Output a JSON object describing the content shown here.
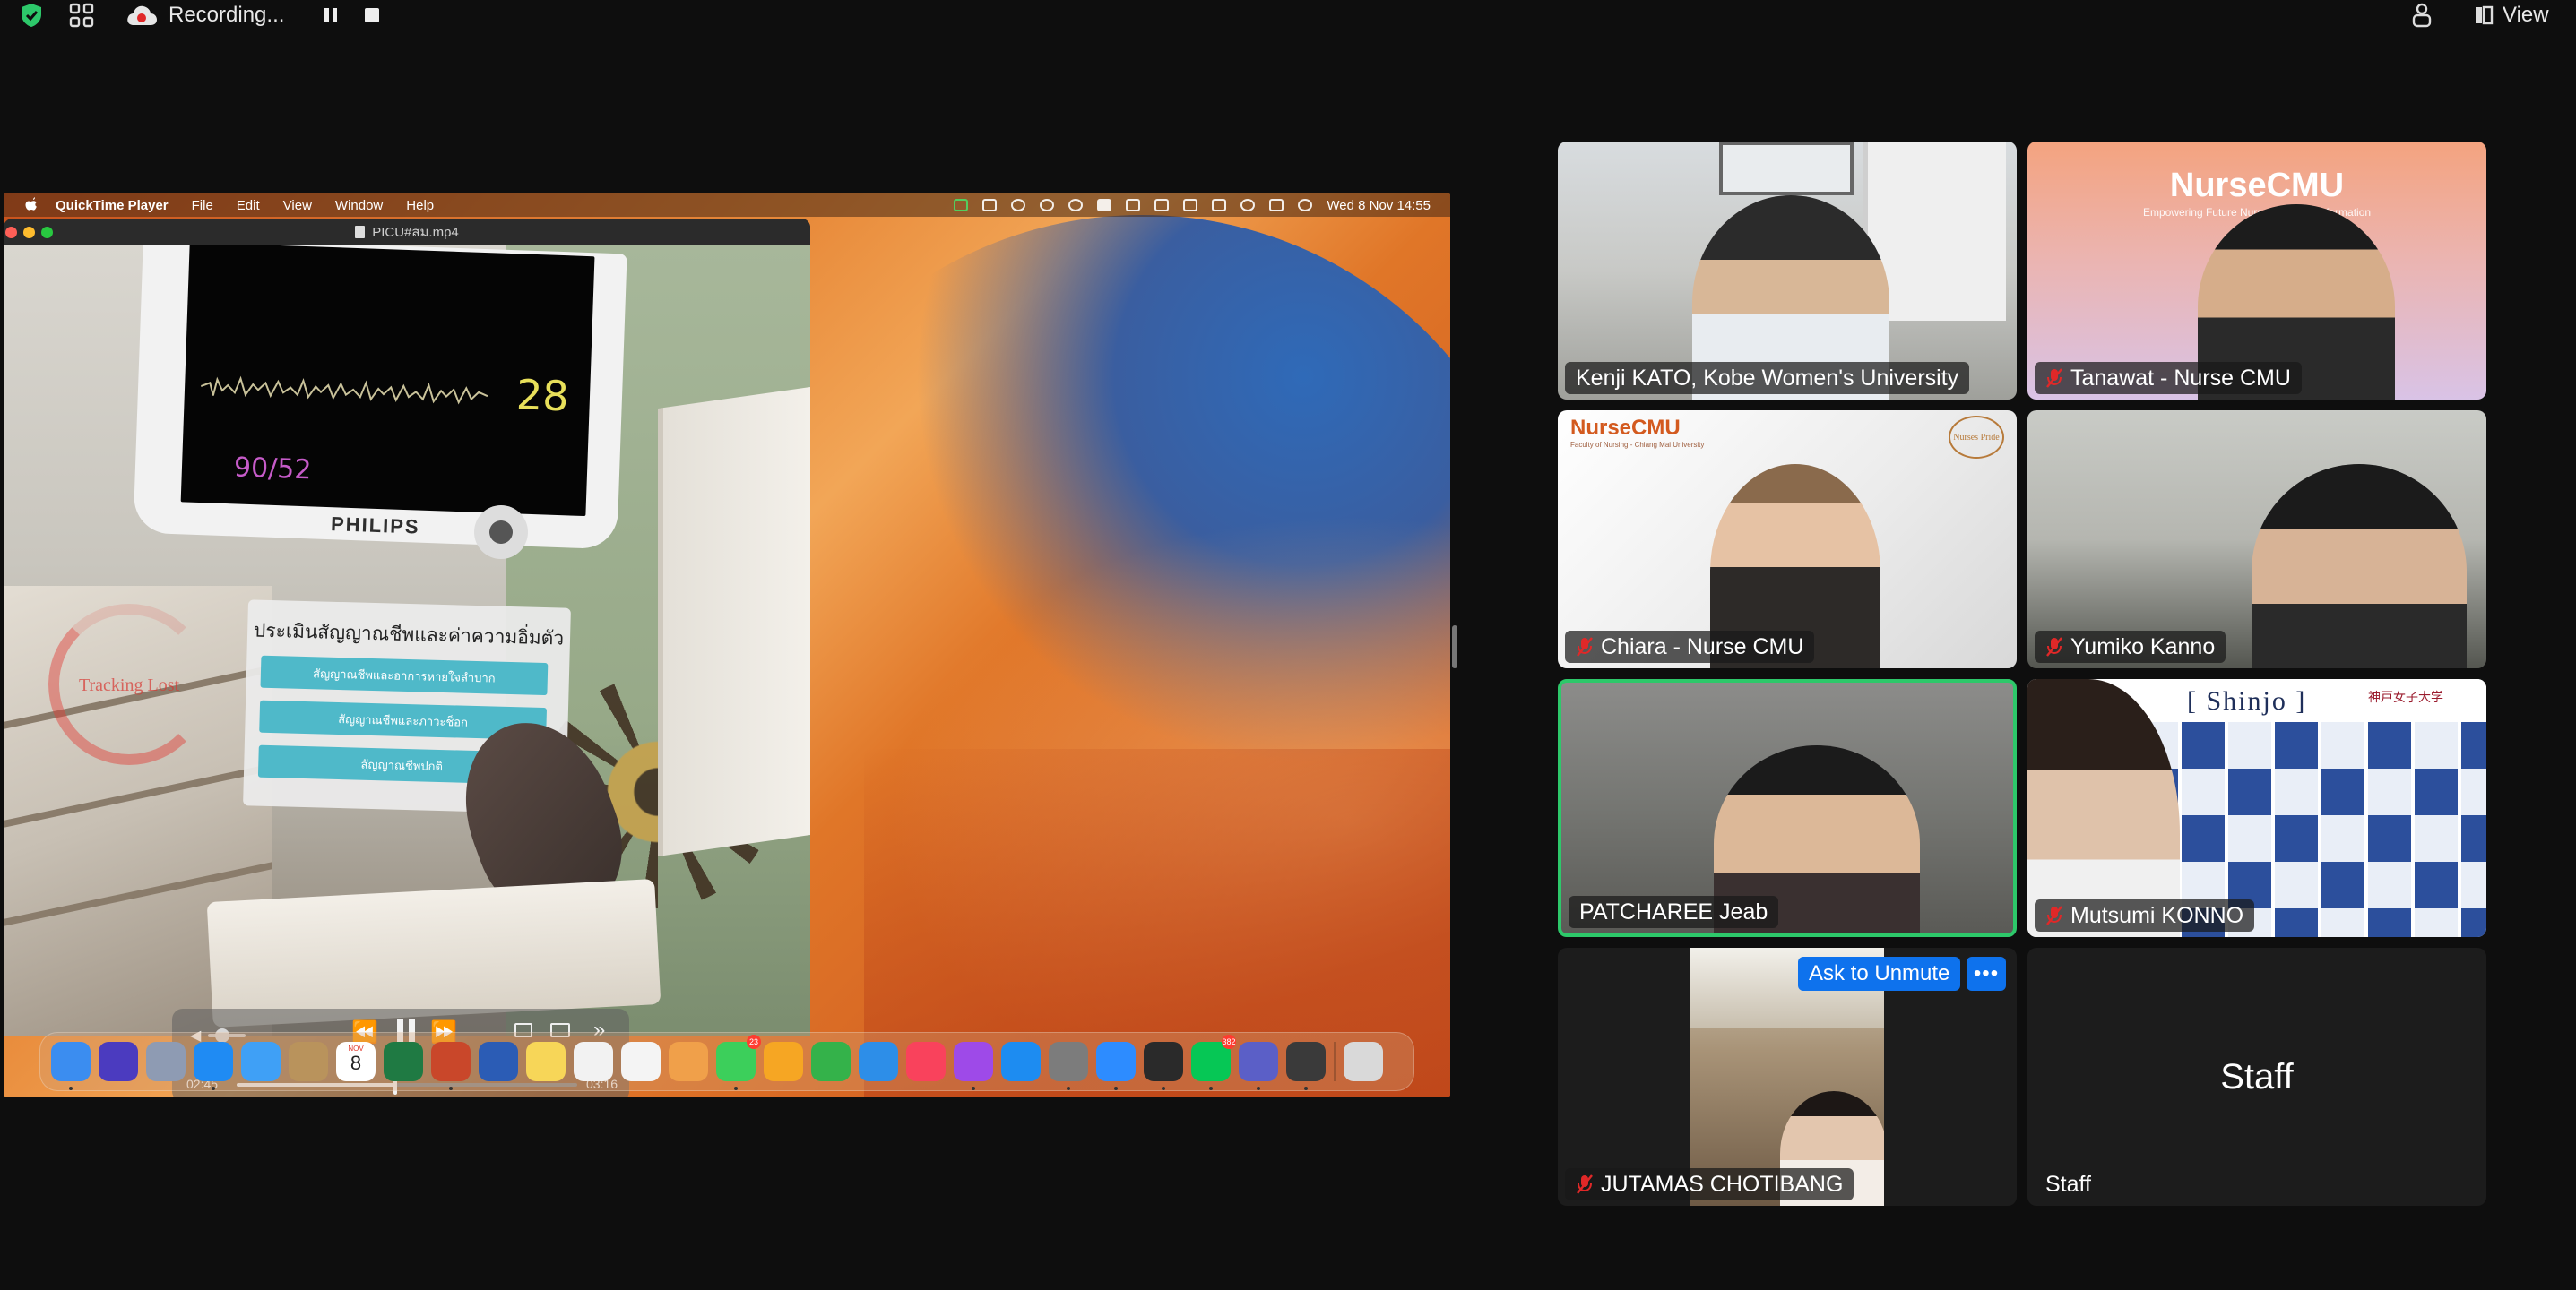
{
  "zoom_toolbar": {
    "recording_label": "Recording...",
    "view_label": "View",
    "icons": [
      "shield-check-icon",
      "apps-grid-icon",
      "cloud-recording-icon",
      "pause-icon",
      "stop-icon",
      "immersive-icon",
      "view-icon"
    ]
  },
  "shared_screen": {
    "mac_menu": {
      "app_name": "QuickTime Player",
      "items": [
        "File",
        "Edit",
        "View",
        "Window",
        "Help"
      ],
      "clock": "Wed 8 Nov  14:55"
    },
    "quicktime": {
      "window_title": "PICU#สม.mp4",
      "elapsed": "02:45",
      "remaining": "03:16",
      "progress_fraction": 0.46
    },
    "video": {
      "heart_rate": "28",
      "blood_pressure": "90/52",
      "monitor_brand": "PHILIPS",
      "menu_title": "ประเมินสัญญาณชีพและค่าความอิ่มตัว",
      "menu_options": [
        "สัญญาณชีพและอาการหายใจลำบาก",
        "สัญญาณชีพและภาวะช็อก",
        "สัญญาณชีพปกติ"
      ],
      "tracking_label": "Tracking Lost"
    },
    "dock": {
      "calendar_month": "NOV",
      "calendar_day": "8",
      "apps": [
        {
          "name": "finder",
          "color": "#3b8df0"
        },
        {
          "name": "siri",
          "color": "#4b3bbf"
        },
        {
          "name": "launchpad",
          "color": "#8e9bb3"
        },
        {
          "name": "safari",
          "color": "#1f8bf3"
        },
        {
          "name": "mail",
          "color": "#3fa0f6"
        },
        {
          "name": "contacts",
          "color": "#b9935c"
        },
        {
          "name": "calendar",
          "color": "#ffffff"
        },
        {
          "name": "excel",
          "color": "#1f7a43"
        },
        {
          "name": "powerpoint",
          "color": "#c9472a"
        },
        {
          "name": "word",
          "color": "#2b5cb5"
        },
        {
          "name": "notes",
          "color": "#f7d658"
        },
        {
          "name": "freeform",
          "color": "#f2f2f2"
        },
        {
          "name": "reminders",
          "color": "#f4f4f4"
        },
        {
          "name": "photos",
          "color": "#f0a04a"
        },
        {
          "name": "messages",
          "color": "#3ccf5b"
        },
        {
          "name": "pages",
          "color": "#f6a623"
        },
        {
          "name": "numbers",
          "color": "#34b24a"
        },
        {
          "name": "keynote",
          "color": "#2d8ee8"
        },
        {
          "name": "music",
          "color": "#f9425c"
        },
        {
          "name": "podcasts",
          "color": "#9e4ae8"
        },
        {
          "name": "app-store",
          "color": "#1d8cf1"
        },
        {
          "name": "system-settings",
          "color": "#7c7c7c"
        },
        {
          "name": "zoom",
          "color": "#2d8cff"
        },
        {
          "name": "vmware",
          "color": "#2a2a2a"
        },
        {
          "name": "line",
          "color": "#06c755"
        },
        {
          "name": "teams",
          "color": "#5b5fc7"
        },
        {
          "name": "quicktime",
          "color": "#3a3a3a"
        },
        {
          "name": "trash",
          "color": "#d9d9d9"
        }
      ],
      "badges": {
        "messages": "23",
        "line": "382"
      }
    }
  },
  "participants": [
    {
      "id": "kenji",
      "name": "Kenji KATO, Kobe Women's University",
      "muted": false,
      "active": false
    },
    {
      "id": "tanawat",
      "name": "Tanawat - Nurse CMU",
      "muted": true,
      "active": false
    },
    {
      "id": "chiara",
      "name": "Chiara - Nurse CMU",
      "muted": true,
      "active": false
    },
    {
      "id": "yumiko",
      "name": "Yumiko Kanno",
      "muted": true,
      "active": false
    },
    {
      "id": "patcharee",
      "name": "PATCHAREE Jeab",
      "muted": false,
      "active": true
    },
    {
      "id": "mutsumi",
      "name": "Mutsumi KONNO",
      "muted": true,
      "active": false
    },
    {
      "id": "jutamas",
      "name": "JUTAMAS CHOTIBANG",
      "muted": true,
      "active": false
    },
    {
      "id": "staff",
      "name": "Staff",
      "muted": false,
      "active": false
    }
  ],
  "tiles": {
    "tanawat_brand": "NurseCMU",
    "tanawat_tagline": "Empowering Future Nurses with Transformation",
    "chiara_brand": "NurseCMU",
    "chiara_brand_sub": "Faculty of Nursing - Chiang Mai University",
    "chiara_logo": "Nurses Pride",
    "mutsumi_sign": "[ Shinjo ]",
    "mutsumi_logo": "神戸女子大学",
    "ask_unmute": "Ask to Unmute",
    "more": "•••",
    "staff_center": "Staff"
  },
  "colors": {
    "active_speaker": "#2dc86a",
    "zoom_blue": "#0e72ed",
    "muted_red": "#e02828"
  }
}
